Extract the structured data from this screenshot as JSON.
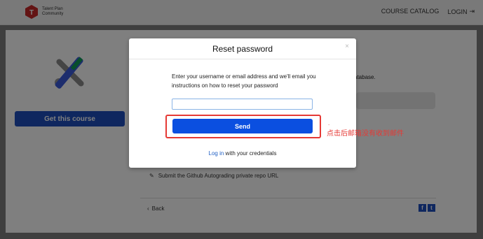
{
  "header": {
    "logo_text": "Talent Plan Community",
    "nav": {
      "course_catalog": "COURSE CATALOG",
      "login": "LOGIN"
    }
  },
  "background": {
    "get_course_label": "Get this course",
    "db_text": "atabase.",
    "task_text": "Submit the Github Autograding private repo URL",
    "back_label": "Back"
  },
  "modal": {
    "title": "Reset password",
    "close": "×",
    "description": "Enter your username or email address and we'll email you instructions on how to reset your password",
    "input_value": "",
    "send_label": "Send",
    "login_link": "Log in",
    "login_suffix": " with your credentials"
  },
  "annotation": {
    "dot": ".",
    "text": "点击后邮箱没有收到邮件",
    "color": "#e53935"
  },
  "colors": {
    "primary": "#1f4fbf",
    "send": "#0b4fe0",
    "highlight": "#e53935"
  }
}
